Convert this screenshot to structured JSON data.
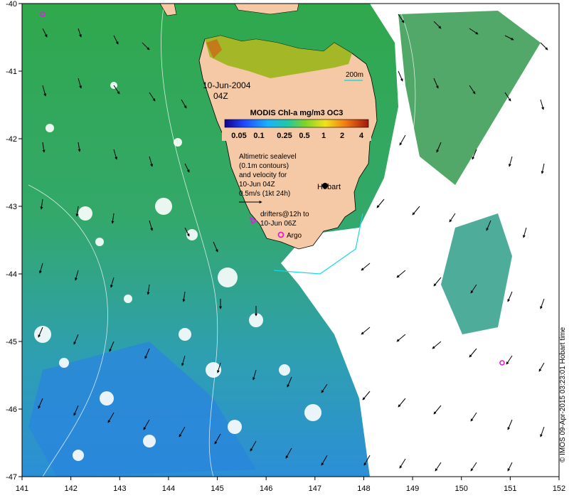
{
  "map": {
    "date_label": "10-Jun-2004",
    "time_label": "04Z",
    "contour_label": "200m",
    "hobart_label": "Hobart",
    "argo_label": "Argo",
    "altimetry_lines": [
      "Altimetric sealevel",
      "(0.1m contours)",
      "and velocity for",
      "10-Jun 04Z",
      "0.5m/s (1kt 24h)"
    ],
    "drifter_lines": [
      "drifters@12h to",
      "10-Jun 06Z"
    ],
    "credit": "© IMOS 09-Apr-2015 03:23:01 Hobart time"
  },
  "colorbar": {
    "title": "MODIS Chl-a mg/m3 OC3",
    "ticks": [
      "0.05",
      "0.1",
      "0.25",
      "0.5",
      "1",
      "2",
      "4"
    ]
  },
  "axes": {
    "x_ticks": [
      "141",
      "142",
      "143",
      "144",
      "145",
      "146",
      "147",
      "148",
      "149",
      "150",
      "151",
      "152"
    ],
    "y_ticks": [
      "-40",
      "-41",
      "-42",
      "-43",
      "-44",
      "-45",
      "-46",
      "-47"
    ]
  },
  "colors": {
    "land": "#f5c9a5",
    "high_chl": "#9ab51a",
    "low_chl": "#2a9fd8",
    "contour": "#19d9e0",
    "argo": "#e01ee0"
  }
}
